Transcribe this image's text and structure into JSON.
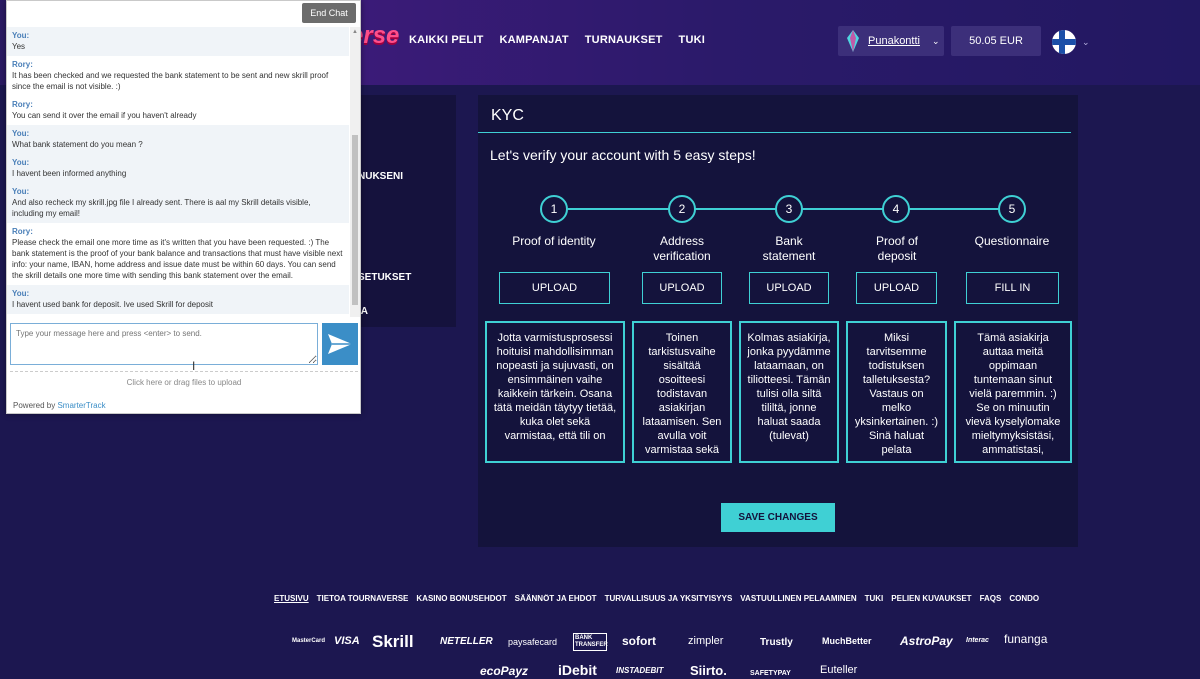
{
  "header": {
    "logo_text": "erse",
    "nav": [
      "KAIKKI PELIT",
      "KAMPANJAT",
      "TURNAUKSET",
      "TUKI"
    ],
    "account_name": "Punakontti",
    "balance": "50.05 EUR",
    "language_icon": "finland-flag-icon"
  },
  "side_menu": {
    "items": [
      "NUKSENI",
      "SETUKSET",
      "IA"
    ]
  },
  "kyc": {
    "title": "KYC",
    "intro": "Let's verify your account with 5 easy steps!",
    "steps": [
      {
        "num": "1",
        "title": "Proof of identity",
        "button": "UPLOAD",
        "desc": "Jotta varmistusprosessi hoituisi mahdollisimman nopeasti ja sujuvasti, on ensimmäinen vaihe kaikkein tärkein. Osana tätä meidän täytyy tietää, kuka olet sekä varmistaa, että tili on"
      },
      {
        "num": "2",
        "title": "Address verification",
        "button": "UPLOAD",
        "desc": "Toinen tarkistusvaihe sisältää osoitteesi todistavan asiakirjan lataamisen. Sen avulla voit varmistaa sekä"
      },
      {
        "num": "3",
        "title": "Bank statement",
        "button": "UPLOAD",
        "desc": "Kolmas asiakirja, jonka pyydämme lataamaan, on tiliotteesi. Tämän tulisi olla siltä tililtä, jonne haluat saada (tulevat)"
      },
      {
        "num": "4",
        "title": "Proof of deposit",
        "button": "UPLOAD",
        "desc": "Miksi tarvitsemme todistuksen talletuksesta? Vastaus on melko yksinkertainen. :) Sinä haluat pelata"
      },
      {
        "num": "5",
        "title": "Questionnaire",
        "button": "FILL IN",
        "desc": "Tämä asiakirja auttaa meitä oppimaan tuntemaan sinut vielä paremmin. :) Se on minuutin vievä kyselylomake mieltymyksistäsi, ammatistasi,"
      }
    ],
    "save_label": "SAVE CHANGES"
  },
  "footer": {
    "links": [
      "ETUSIVU",
      "TIETOA TOURNAVERSE",
      "KASINO BONUSEHDOT",
      "SÄÄNNÖT JA EHDOT",
      "TURVALLISUUS JA YKSITYISYYS",
      "VASTUULLINEN PELAAMINEN",
      "TUKI",
      "PELIEN KUVAUKSET",
      "FAQS",
      "CONDO"
    ],
    "payments_row1": [
      "MasterCard",
      "VISA",
      "Skrill",
      "NETELLER",
      "paysafecard",
      "BANK TRANSFER",
      "sofort",
      "zimpler",
      "Trustly",
      "MuchBetter",
      "AstroPay",
      "Interac",
      "funanga"
    ],
    "payments_row2": [
      "ecoPayz",
      "iDebit",
      "INSTADEBIT",
      "Siirto.",
      "SAFETYPAY",
      "Euteller"
    ]
  },
  "chat": {
    "end_chat_label": "End Chat",
    "messages": [
      {
        "who": "You:",
        "text": "Yes",
        "type": "you"
      },
      {
        "who": "Rory:",
        "text": "It has been checked and we requested the bank statement to be sent and new skrill proof since the email is not visible. :)",
        "type": "rep"
      },
      {
        "who": "Rory:",
        "text": "You can send it over the email if you haven't already",
        "type": "rep"
      },
      {
        "who": "You:",
        "text": "What bank statement do you mean ?",
        "type": "you"
      },
      {
        "who": "You:",
        "text": "I havent been informed anything",
        "type": "you"
      },
      {
        "who": "You:",
        "text": "And also recheck my skrill.jpg file I already sent. There is aal my Skrill details visible, including my email!",
        "type": "you"
      },
      {
        "who": "Rory:",
        "text": "Please check the email one more time as it's written that you have been requested. :) The bank statement is the proof of your bank balance and transactions that must have visible next info: your name, IBAN, home address and issue date must be within 60 days. You can send the skrill details one more time with sending this bank statement over the email.",
        "type": "rep"
      },
      {
        "who": "You:",
        "text": "I havent used bank for deposit. Ive used Skrill for deposit",
        "type": "you"
      }
    ],
    "input_placeholder": "Type your message here and press <enter> to send.",
    "upload_label": "Click here or drag files to upload",
    "powered_prefix": "Powered by ",
    "powered_brand": "SmarterTrack"
  }
}
